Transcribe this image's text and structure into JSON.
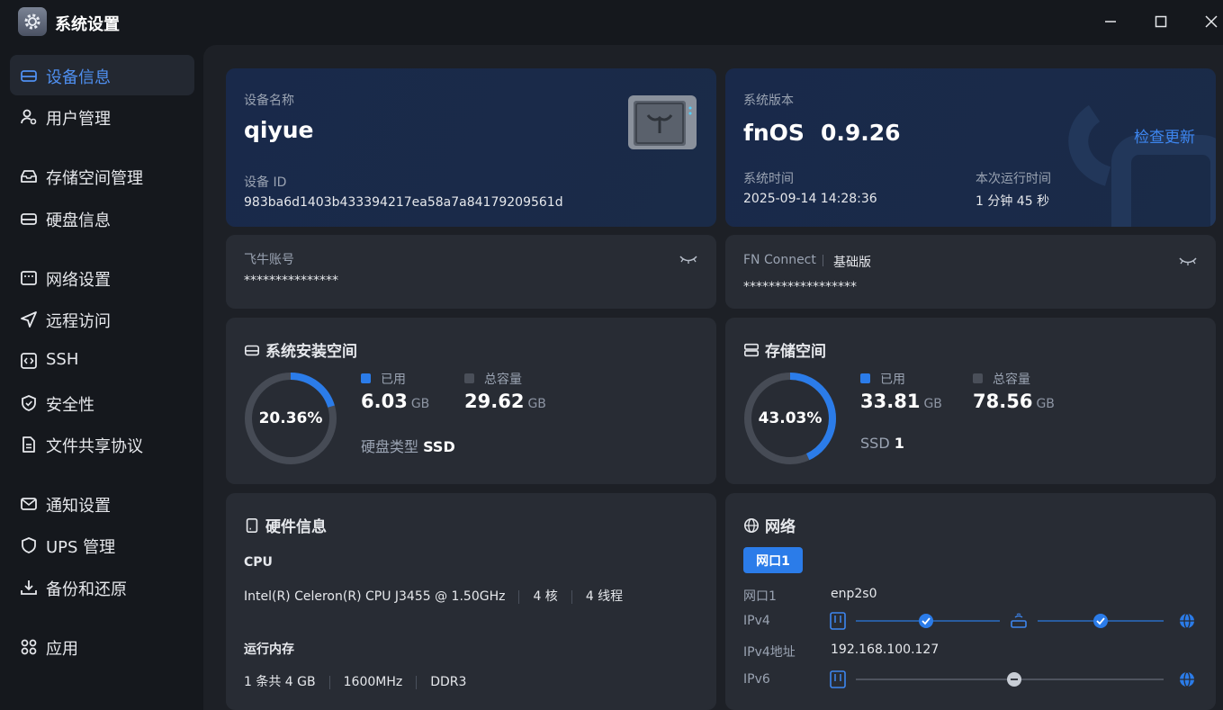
{
  "window": {
    "title": "系统设置"
  },
  "sidebar": {
    "items": [
      {
        "label": "设备信息",
        "icon": "hard-drive-icon",
        "active": true
      },
      {
        "label": "用户管理",
        "icon": "user-gear-icon"
      },
      {
        "label": "存储空间管理",
        "icon": "storage-box-icon"
      },
      {
        "label": "硬盘信息",
        "icon": "disk-icon"
      },
      {
        "label": "网络设置",
        "icon": "network-icon"
      },
      {
        "label": "远程访问",
        "icon": "send-icon"
      },
      {
        "label": "SSH",
        "icon": "code-icon"
      },
      {
        "label": "安全性",
        "icon": "shield-icon"
      },
      {
        "label": "文件共享协议",
        "icon": "file-icon"
      },
      {
        "label": "通知设置",
        "icon": "mail-icon"
      },
      {
        "label": "UPS 管理",
        "icon": "ups-shield-icon"
      },
      {
        "label": "备份和还原",
        "icon": "download-icon"
      },
      {
        "label": "应用",
        "icon": "apps-icon"
      }
    ]
  },
  "device": {
    "name_label": "设备名称",
    "name": "qiyue",
    "id_label": "设备 ID",
    "id": "983ba6d1403b433394217ea58a7a84179209561d"
  },
  "system": {
    "version_label": "系统版本",
    "os": "fnOS",
    "version": "0.9.26",
    "check_update": "检查更新",
    "time_label": "系统时间",
    "time": "2025-09-14 14:28:36",
    "uptime_label": "本次运行时间",
    "uptime": "1 分钟 45 秒"
  },
  "account": {
    "label": "飞牛账号",
    "value": "***************"
  },
  "connect": {
    "label": "FN Connect",
    "plan": "基础版",
    "value": "******************"
  },
  "install_space": {
    "title": "系统安装空间",
    "percent": 20.36,
    "percent_text": "20.36%",
    "used_label": "已用",
    "used": "6.03",
    "total_label": "总容量",
    "total": "29.62",
    "unit": "GB",
    "disk_type_label": "硬盘类型",
    "disk_type": "SSD"
  },
  "storage_space": {
    "title": "存储空间",
    "percent": 43.03,
    "percent_text": "43.03%",
    "used_label": "已用",
    "used": "33.81",
    "total_label": "总容量",
    "total": "78.56",
    "unit": "GB",
    "ssd_label": "SSD",
    "ssd_count": "1"
  },
  "hardware": {
    "title": "硬件信息",
    "cpu_label": "CPU",
    "cpu_model": "Intel(R) Celeron(R) CPU J3455 @ 1.50GHz",
    "cores": "4 核",
    "threads": "4 线程",
    "mem_label": "运行内存",
    "mem_count": "1 条共 4 GB",
    "mem_freq": "1600MHz",
    "mem_type": "DDR3"
  },
  "network": {
    "title": "网络",
    "tab": "网口1",
    "port_label": "网口1",
    "port": "enp2s0",
    "ipv4_label": "IPv4",
    "ipv4_addr_label": "IPv4地址",
    "ipv4_addr": "192.168.100.127",
    "ipv6_label": "IPv6"
  },
  "colors": {
    "accent": "#2b7ce9",
    "ring_track": "#464b55",
    "card": "#282c34"
  }
}
